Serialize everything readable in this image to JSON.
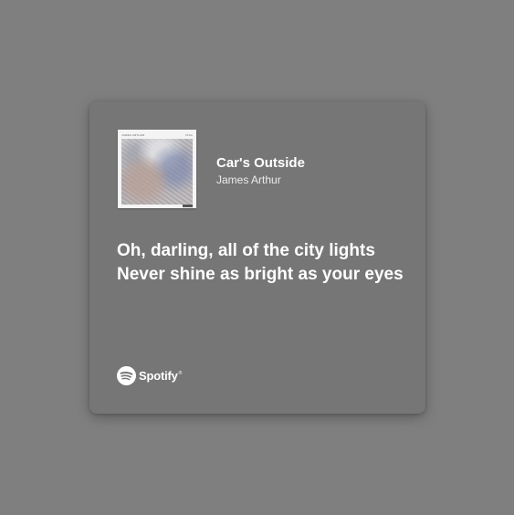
{
  "track": {
    "title": "Car's Outside",
    "artist": "James Arthur"
  },
  "cover": {
    "top_left_text": "JAMES ARTHUR",
    "top_right_text": "PIKA"
  },
  "lyrics": {
    "lines": [
      "Oh, darling, all of the city lights",
      "Never shine as bright as your eyes"
    ]
  },
  "brand": {
    "name": "Spotify",
    "icon": "spotify-logo-icon"
  },
  "colors": {
    "background": "#7f7f7f",
    "card": "#767676",
    "text": "#ffffff"
  }
}
